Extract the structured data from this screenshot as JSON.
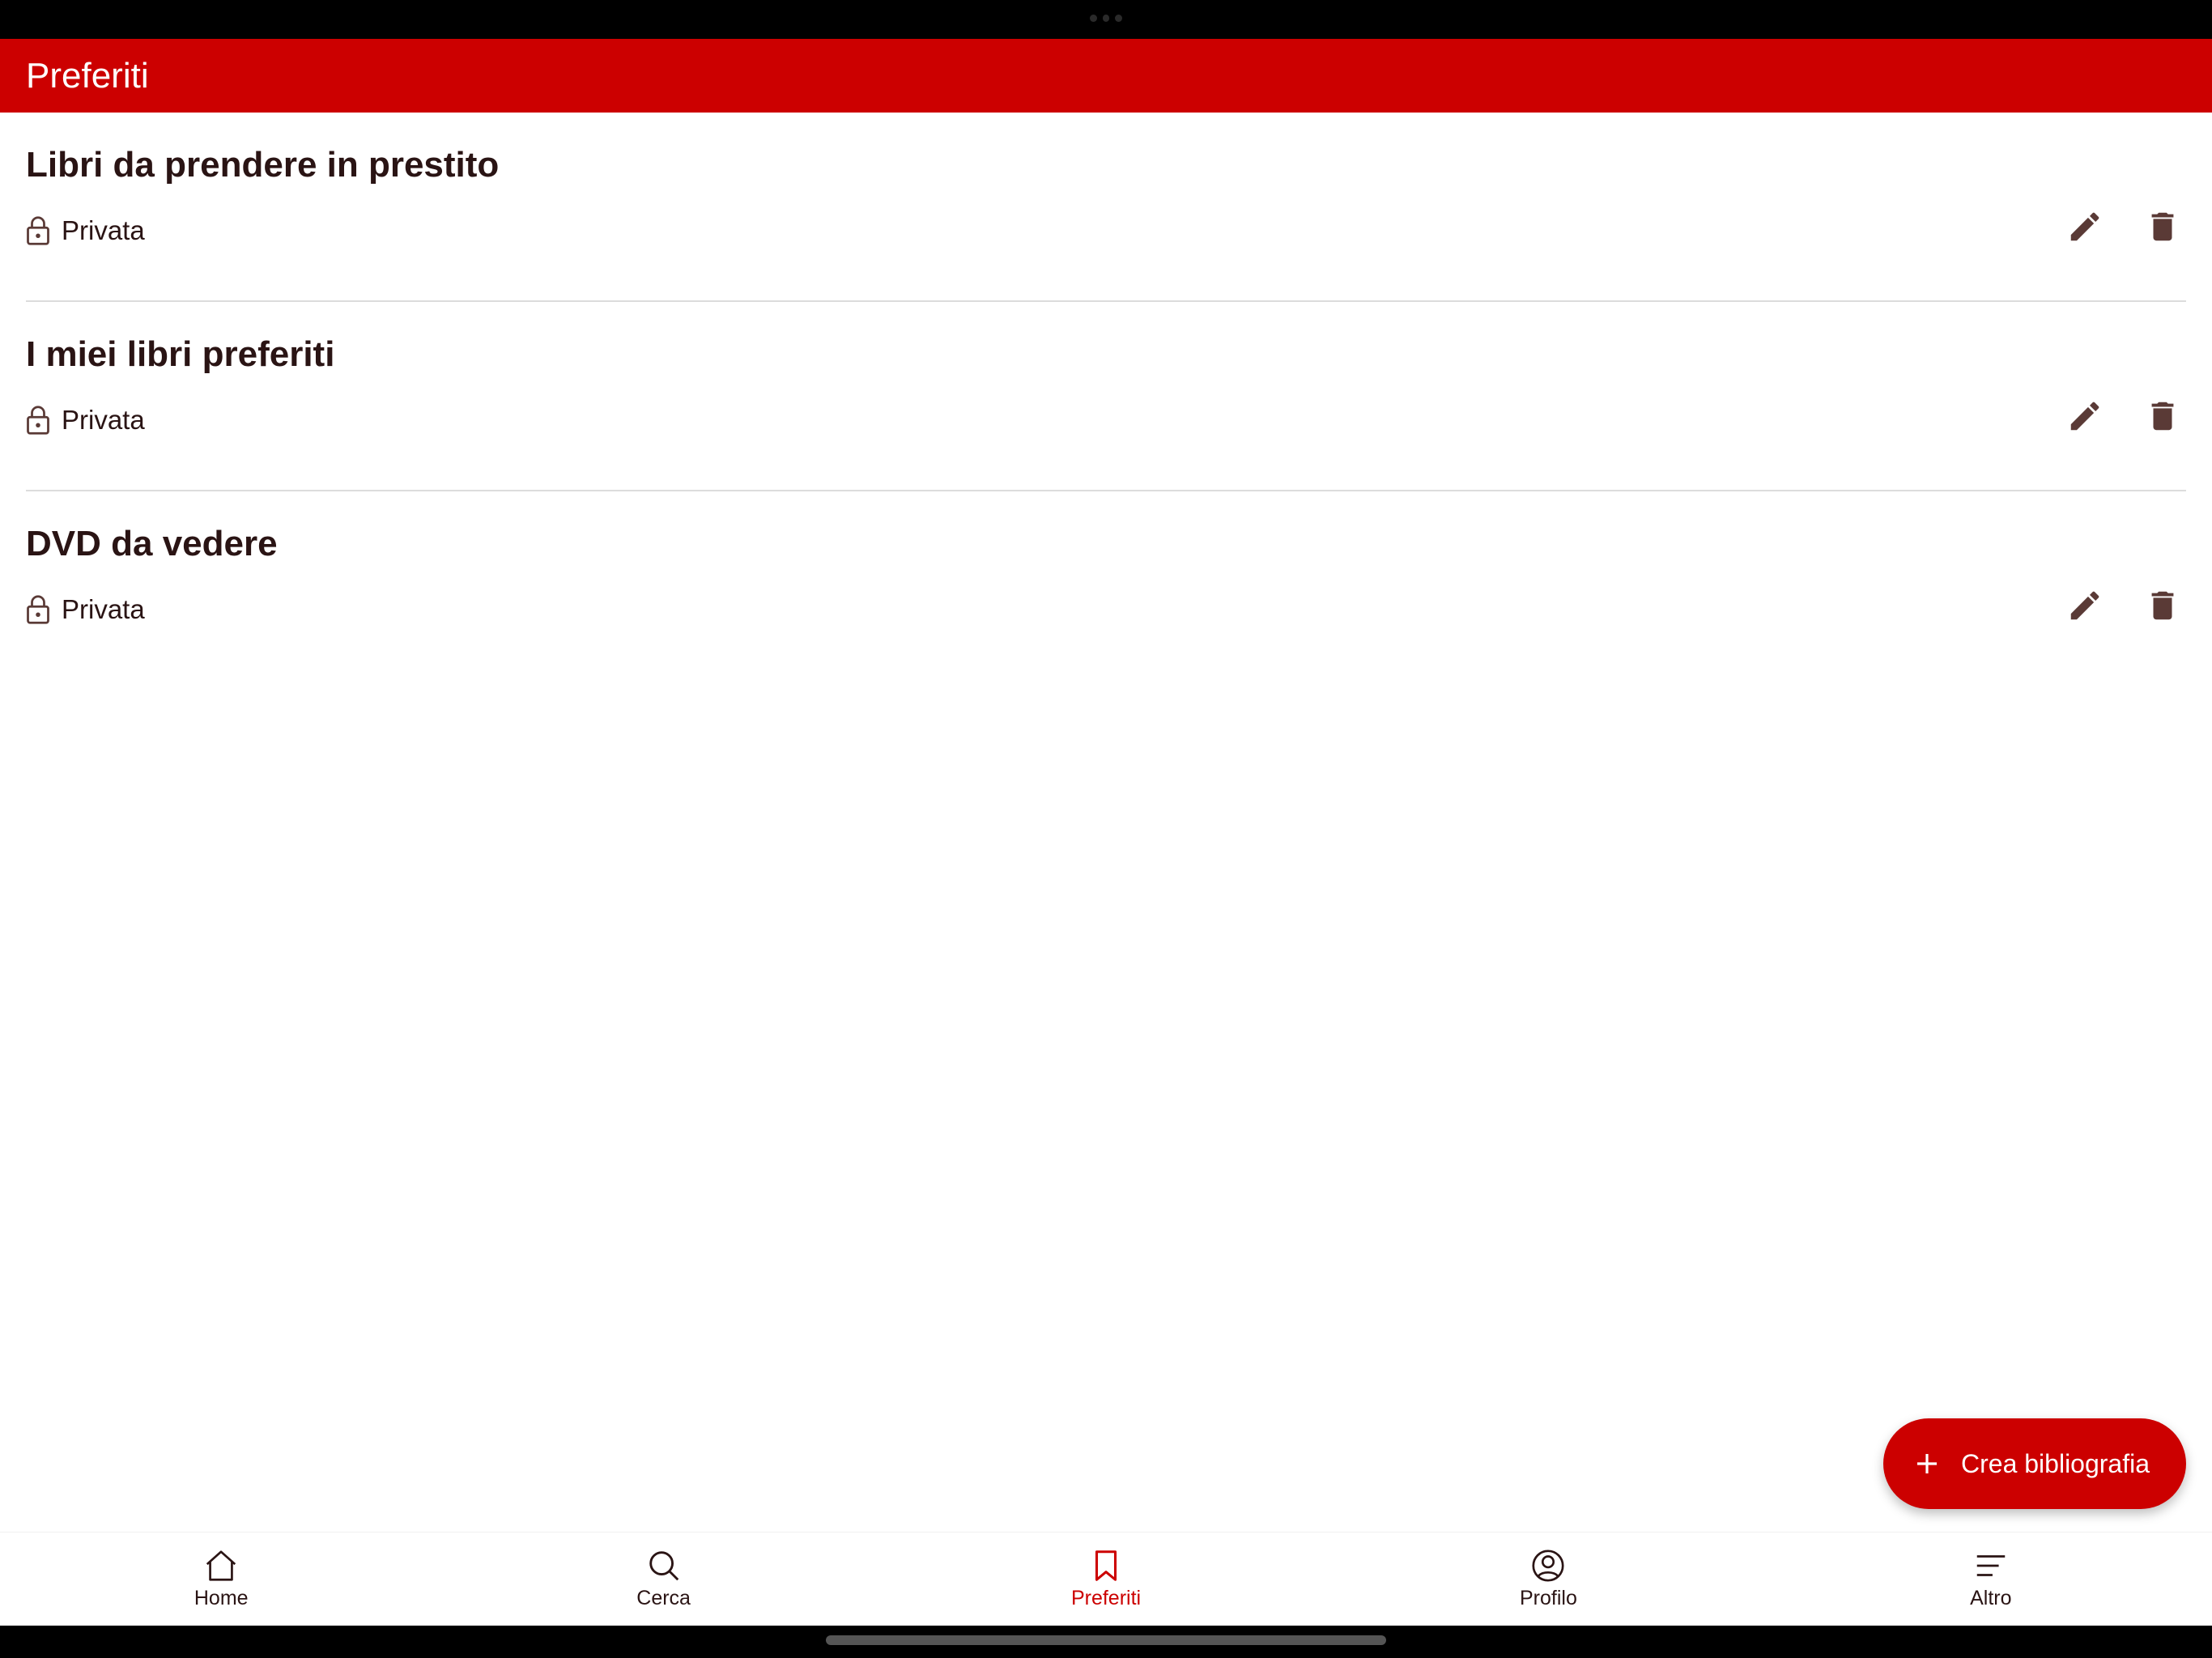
{
  "app_bar": {
    "title": "Preferiti"
  },
  "lists": [
    {
      "title": "Libri da prendere in prestito",
      "privacy": "Privata"
    },
    {
      "title": "I miei libri preferiti",
      "privacy": "Privata"
    },
    {
      "title": "DVD da vedere",
      "privacy": "Privata"
    }
  ],
  "fab": {
    "label": "Crea bibliografia",
    "icon": "plus-icon"
  },
  "bottom_nav": {
    "items": [
      {
        "label": "Home",
        "icon": "home-icon"
      },
      {
        "label": "Cerca",
        "icon": "search-icon"
      },
      {
        "label": "Preferiti",
        "icon": "bookmark-icon",
        "active": true
      },
      {
        "label": "Profilo",
        "icon": "profile-icon"
      },
      {
        "label": "Altro",
        "icon": "menu-icon"
      }
    ]
  },
  "colors": {
    "primary": "#cc0000",
    "text": "#2a1414",
    "icon": "#5a3a36",
    "divider": "#dcdcdc"
  }
}
